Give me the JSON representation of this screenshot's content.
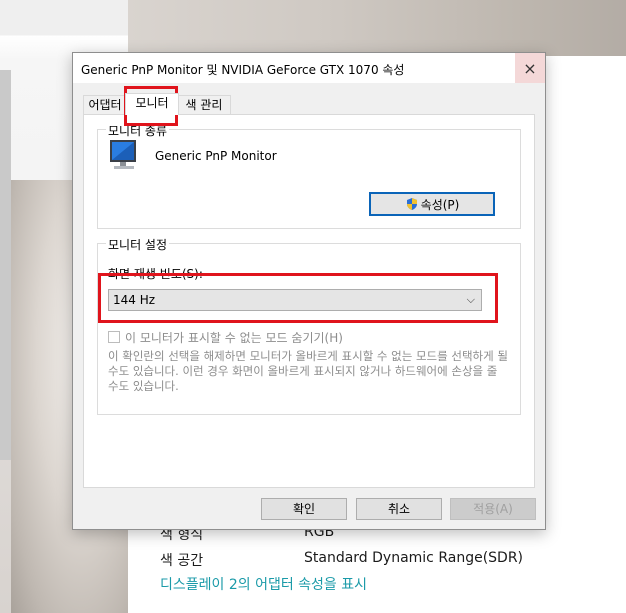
{
  "dialog": {
    "title": "Generic PnP Monitor 및 NVIDIA GeForce GTX 1070 속성",
    "close_icon": "×",
    "tabs": [
      {
        "label": "어댑터",
        "active": false
      },
      {
        "label": "모니터",
        "active": true
      },
      {
        "label": "색 관리",
        "active": false
      }
    ],
    "monitor_type": {
      "group_title": "모니터 종류",
      "name": "Generic PnP Monitor",
      "properties_button": "속성(P)"
    },
    "monitor_settings": {
      "group_title": "모니터 설정",
      "refresh_label": "화면 재생 빈도(S):",
      "refresh_value": "144 Hz",
      "hide_modes_label": "이 모니터가 표시할 수 없는 모드 숨기기(H)",
      "hide_modes_checked": false,
      "description": "이 확인란의 선택을 해제하면 모니터가 올바르게 표시할 수 없는 모드를 선택하게 될 수도 있습니다. 이런 경우 화면이 올바르게 표시되지 않거나 하드웨어에 손상을 줄 수도 있습니다."
    },
    "buttons": {
      "ok": "확인",
      "cancel": "취소",
      "apply": "적용(A)"
    }
  },
  "background": {
    "rows": [
      {
        "label": "색 형식",
        "value": "RGB"
      },
      {
        "label": "색 공간",
        "value": "Standard Dynamic Range(SDR)"
      }
    ],
    "link": "디스플레이 2의 어댑터 속성을 표시"
  },
  "colors": {
    "highlight": "#e0141c",
    "link": "#1a9aa8",
    "focus": "#0a64b8"
  }
}
